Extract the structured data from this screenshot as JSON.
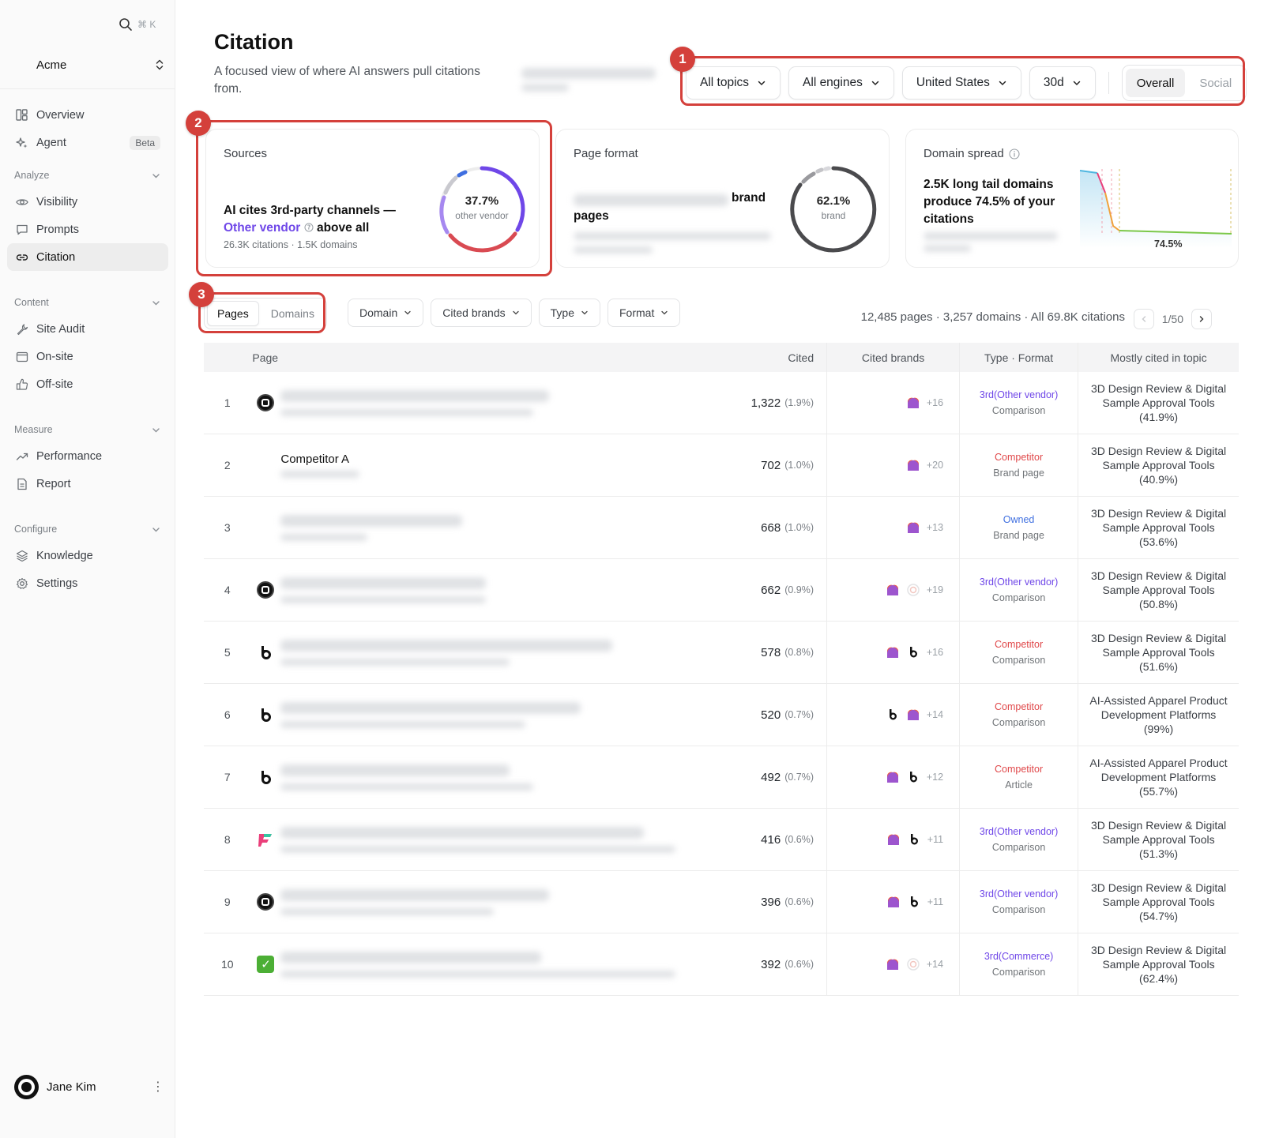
{
  "sidebar": {
    "search_shortcut": "⌘ K",
    "workspace": "Acme",
    "top_items": [
      {
        "label": "Overview",
        "icon": "layout-icon"
      },
      {
        "label": "Agent",
        "icon": "sparkle-icon",
        "badge": "Beta"
      }
    ],
    "sections": [
      {
        "label": "Analyze",
        "items": [
          {
            "label": "Visibility",
            "icon": "eye-icon"
          },
          {
            "label": "Prompts",
            "icon": "message-icon"
          },
          {
            "label": "Citation",
            "icon": "link-icon",
            "active": true
          }
        ]
      },
      {
        "label": "Content",
        "items": [
          {
            "label": "Site Audit",
            "icon": "wrench-icon"
          },
          {
            "label": "On-site",
            "icon": "browser-icon"
          },
          {
            "label": "Off-site",
            "icon": "thumbs-up-icon"
          }
        ]
      },
      {
        "label": "Measure",
        "items": [
          {
            "label": "Performance",
            "icon": "trend-icon"
          },
          {
            "label": "Report",
            "icon": "document-icon"
          }
        ]
      },
      {
        "label": "Configure",
        "items": [
          {
            "label": "Knowledge",
            "icon": "layers-icon"
          },
          {
            "label": "Settings",
            "icon": "gear-icon"
          }
        ]
      }
    ],
    "user": {
      "name": "Jane Kim"
    }
  },
  "header": {
    "title": "Citation",
    "subtitle": "A focused view of where AI answers pull citations from."
  },
  "filters": {
    "topics": "All topics",
    "engines": "All engines",
    "country": "United States",
    "period": "30d",
    "view_options": [
      "Overall",
      "Social"
    ],
    "view_selected": "Overall"
  },
  "markers": [
    "1",
    "2",
    "3"
  ],
  "cards": {
    "sources": {
      "title": "Sources",
      "headline_prefix": "AI cites 3rd-party channels —",
      "accent": "Other vendor",
      "headline_suffix": "above all",
      "meta": "26.3K citations · 1.5K domains",
      "pct": "37.7%",
      "pct_label": "other vendor"
    },
    "page_format": {
      "title": "Page format",
      "headline_tail_1": "brand",
      "headline_tail_2": "pages",
      "pct": "62.1%",
      "pct_label": "brand"
    },
    "domain_spread": {
      "title": "Domain spread",
      "headline": "2.5K long tail domains produce 74.5% of your citations",
      "value_label": "74.5%"
    }
  },
  "table_controls": {
    "tabs": [
      "Pages",
      "Domains"
    ],
    "tab_selected": "Pages",
    "filters": [
      "Domain",
      "Cited brands",
      "Type",
      "Format"
    ],
    "summary": "12,485 pages · 3,257 domains · All 69.8K citations",
    "page": "1/50"
  },
  "table": {
    "columns": {
      "page": "Page",
      "cited": "Cited",
      "brands": "Cited brands",
      "type": "Type · Format",
      "topic": "Mostly cited in topic"
    },
    "rows": [
      {
        "n": "1",
        "fav": "dark",
        "name": "",
        "cited": "1,322",
        "share": "(1.9%)",
        "brands": [
          "flame"
        ],
        "more": "+16",
        "type": "3rd(Other vendor)",
        "tclass": "vendor",
        "format": "Comparison",
        "topic": "3D Design Review & Digital Sample Approval Tools (41.9%)"
      },
      {
        "n": "2",
        "fav": "none",
        "name": "Competitor A",
        "cited": "702",
        "share": "(1.0%)",
        "brands": [
          "flame"
        ],
        "more": "+20",
        "type": "Competitor",
        "tclass": "comp",
        "format": "Brand page",
        "topic": "3D Design Review & Digital Sample Approval Tools (40.9%)"
      },
      {
        "n": "3",
        "fav": "none",
        "name": "",
        "cited": "668",
        "share": "(1.0%)",
        "brands": [
          "flame"
        ],
        "more": "+13",
        "type": "Owned",
        "tclass": "owned",
        "format": "Brand page",
        "topic": "3D Design Review & Digital Sample Approval Tools (53.6%)"
      },
      {
        "n": "4",
        "fav": "dark",
        "name": "",
        "cited": "662",
        "share": "(0.9%)",
        "brands": [
          "flame",
          "ring"
        ],
        "more": "+19",
        "type": "3rd(Other vendor)",
        "tclass": "vendor",
        "format": "Comparison",
        "topic": "3D Design Review & Digital Sample Approval Tools (50.8%)"
      },
      {
        "n": "5",
        "fav": "drop",
        "name": "",
        "cited": "578",
        "share": "(0.8%)",
        "brands": [
          "flame",
          "drop"
        ],
        "more": "+16",
        "type": "Competitor",
        "tclass": "comp",
        "format": "Comparison",
        "topic": "3D Design Review & Digital Sample Approval Tools (51.6%)"
      },
      {
        "n": "6",
        "fav": "drop",
        "name": "",
        "cited": "520",
        "share": "(0.7%)",
        "brands": [
          "drop",
          "flame"
        ],
        "more": "+14",
        "type": "Competitor",
        "tclass": "comp",
        "format": "Comparison",
        "topic": "AI-Assisted Apparel Product Development Platforms (99%)"
      },
      {
        "n": "7",
        "fav": "drop",
        "name": "",
        "cited": "492",
        "share": "(0.7%)",
        "brands": [
          "flame",
          "drop"
        ],
        "more": "+12",
        "type": "Competitor",
        "tclass": "comp",
        "format": "Article",
        "topic": "AI-Assisted Apparel Product Development Platforms (55.7%)"
      },
      {
        "n": "8",
        "fav": "ribbon",
        "name": "",
        "cited": "416",
        "share": "(0.6%)",
        "brands": [
          "flame",
          "drop"
        ],
        "more": "+11",
        "type": "3rd(Other vendor)",
        "tclass": "vendor",
        "format": "Comparison",
        "topic": "3D Design Review & Digital Sample Approval Tools (51.3%)"
      },
      {
        "n": "9",
        "fav": "dark",
        "name": "",
        "cited": "396",
        "share": "(0.6%)",
        "brands": [
          "flame",
          "drop"
        ],
        "more": "+11",
        "type": "3rd(Other vendor)",
        "tclass": "vendor",
        "format": "Comparison",
        "topic": "3D Design Review & Digital Sample Approval Tools (54.7%)"
      },
      {
        "n": "10",
        "fav": "check",
        "name": "",
        "cited": "392",
        "share": "(0.6%)",
        "brands": [
          "flame",
          "ring"
        ],
        "more": "+14",
        "type": "3rd(Commerce)",
        "tclass": "commerce",
        "format": "Comparison",
        "topic": "3D Design Review & Digital Sample Approval Tools (62.4%)"
      }
    ]
  },
  "colors": {
    "accent": "#6f47e8",
    "highlight": "#d4403b",
    "competitor": "#e0484a",
    "owned": "#3f6fe0"
  }
}
